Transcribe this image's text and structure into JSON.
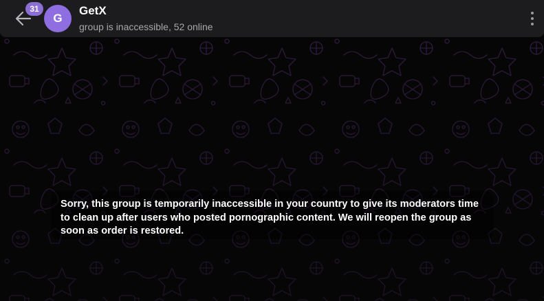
{
  "header": {
    "unread_count": "31",
    "avatar_letter": "G",
    "title": "GetX",
    "status": "group is inaccessible, 52 online",
    "accent_color": "#8e6ee0"
  },
  "icons": {
    "back": "arrow-left-icon",
    "menu": "more-vertical-icon"
  },
  "notice": {
    "text": "Sorry, this group is temporarily inaccessible in your country to give its moderators time to clean up after users who posted pornographic content. We will reopen the group as soon as order is restored."
  }
}
